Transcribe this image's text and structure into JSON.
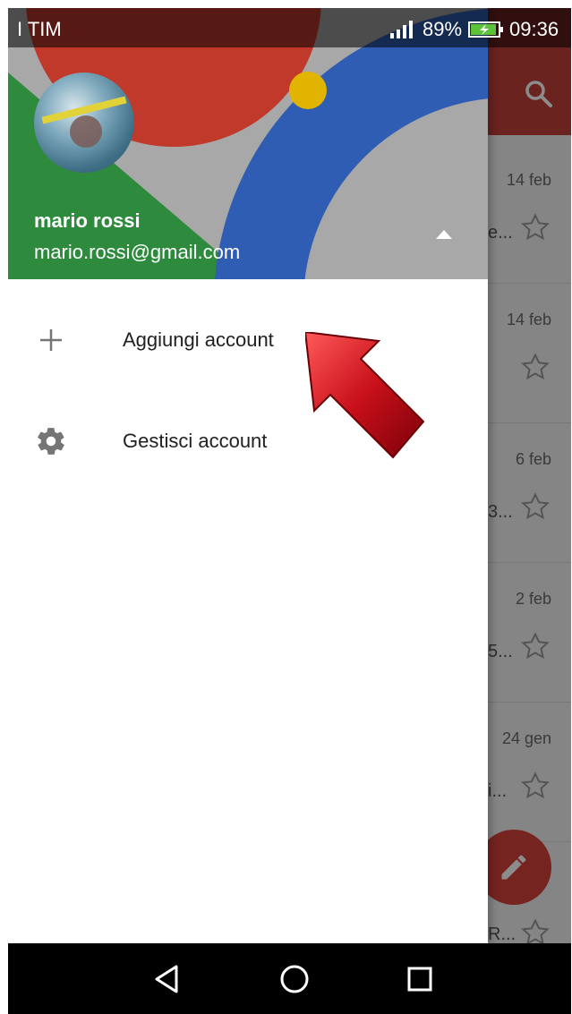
{
  "status_bar": {
    "carrier": "I TIM",
    "battery": "89%",
    "time": "09:36"
  },
  "drawer": {
    "account": {
      "name": "mario rossi",
      "email": "mario.rossi@gmail.com"
    },
    "menu": [
      {
        "label": "Aggiungi account",
        "icon": "plus-icon"
      },
      {
        "label": "Gestisci account",
        "icon": "gear-icon"
      }
    ]
  },
  "inbox": {
    "rows": [
      {
        "date": "14 feb",
        "snippet": "e..."
      },
      {
        "date": "14 feb",
        "snippet": ""
      },
      {
        "date": "6 feb",
        "snippet": "3..."
      },
      {
        "date": "2 feb",
        "snippet": "5..."
      },
      {
        "date": "24 gen",
        "snippet": "i..."
      },
      {
        "date": "",
        "snippet": "R..."
      }
    ]
  },
  "colors": {
    "app_bar": "#c4403a",
    "fab": "#d7423b",
    "arrow": "#c8101a"
  },
  "nav_bar": {
    "buttons": [
      "back-icon",
      "home-icon",
      "recents-icon"
    ]
  }
}
